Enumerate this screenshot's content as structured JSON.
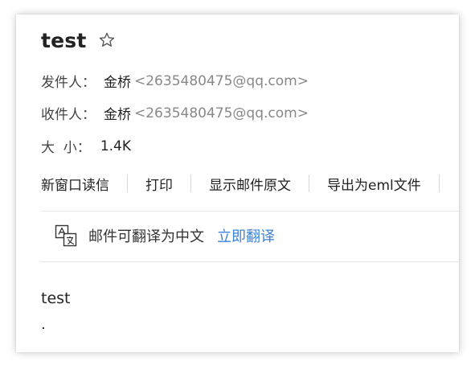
{
  "mail": {
    "subject": "test",
    "from": {
      "label": "发件人：",
      "name": "金桥",
      "email": "<2635480475@qq.com>"
    },
    "to": {
      "label": "收件人：",
      "name": "金桥",
      "email": "<2635480475@qq.com>"
    },
    "size": {
      "label": "大  小：",
      "value": "1.4K"
    },
    "actions": [
      "新窗口读信",
      "打印",
      "显示邮件原文",
      "导出为eml文件"
    ],
    "translate": {
      "prompt": "邮件可翻译为中文",
      "link": "立即翻译"
    },
    "body": {
      "line1": "test",
      "line2": "."
    }
  },
  "colors": {
    "link": "#3d82d6",
    "email_gray": "#888888"
  },
  "icons": {
    "star": "star-outline-icon",
    "translate": "translate-icon"
  }
}
